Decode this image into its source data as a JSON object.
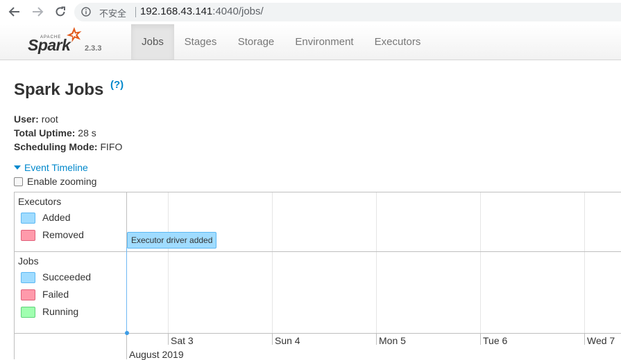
{
  "browser": {
    "insecure_label": "不安全",
    "url_host": "192.168.43.141",
    "url_rest": ":4040/jobs/"
  },
  "nav": {
    "logo_apache": "APACHE",
    "logo_spark": "Spark",
    "version": "2.3.3",
    "tabs": [
      {
        "label": "Jobs"
      },
      {
        "label": "Stages"
      },
      {
        "label": "Storage"
      },
      {
        "label": "Environment"
      },
      {
        "label": "Executors"
      }
    ]
  },
  "page": {
    "title": "Spark Jobs",
    "help": "(?)",
    "user_label": "User:",
    "user_value": "root",
    "uptime_label": "Total Uptime:",
    "uptime_value": "28 s",
    "sched_label": "Scheduling Mode:",
    "sched_value": "FIFO",
    "event_timeline": "Event Timeline",
    "enable_zooming": "Enable zooming"
  },
  "timeline": {
    "executors_title": "Executors",
    "executors_legend": [
      {
        "label": "Added"
      },
      {
        "label": "Removed"
      }
    ],
    "jobs_title": "Jobs",
    "jobs_legend": [
      {
        "label": "Succeeded"
      },
      {
        "label": "Failed"
      },
      {
        "label": "Running"
      }
    ],
    "event_label": "Executor driver added",
    "days": [
      {
        "label": "Sat 3"
      },
      {
        "label": "Sun 4"
      },
      {
        "label": "Mon 5"
      },
      {
        "label": "Tue 6"
      },
      {
        "label": "Wed 7"
      }
    ],
    "month_label": "August 2019"
  },
  "colors": {
    "link": "#0088cc",
    "added_fill": "#a0dcff",
    "added_border": "#5cb8f3",
    "removed_fill": "#ff9aab",
    "removed_border": "#e0607a",
    "running_fill": "#a0ffb0",
    "running_border": "#5fd37a"
  }
}
